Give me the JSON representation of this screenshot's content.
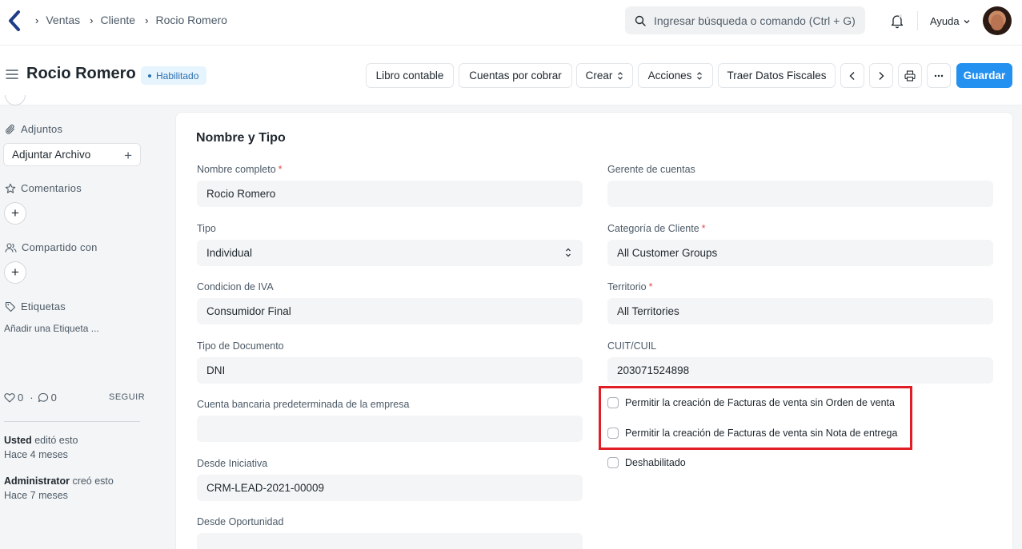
{
  "navbar": {
    "breadcrumbs": [
      "Ventas",
      "Cliente",
      "Rocio Romero"
    ],
    "search_placeholder": "Ingresar búsqueda o comando (Ctrl + G)",
    "help_label": "Ayuda"
  },
  "header": {
    "title": "Rocio Romero",
    "status": "Habilitado",
    "buttons": {
      "ledger": "Libro contable",
      "receivables": "Cuentas por cobrar",
      "create": "Crear",
      "actions": "Acciones",
      "fiscal": "Traer Datos Fiscales",
      "save": "Guardar"
    }
  },
  "sidebar": {
    "attachments_label": "Adjuntos",
    "attach_button": "Adjuntar Archivo",
    "comments_label": "Comentarios",
    "shared_label": "Compartido con",
    "tags_label": "Etiquetas",
    "add_tag": "Añadir una Etiqueta ...",
    "likes_count": "0",
    "comments_count": "0",
    "follow_label": "SEGUIR",
    "activity": [
      {
        "user": "Usted",
        "action": "editó esto",
        "when": "Hace 4 meses"
      },
      {
        "user": "Administrator",
        "action": "creó esto",
        "when": "Hace 7 meses"
      }
    ]
  },
  "form": {
    "section_title": "Nombre y Tipo",
    "left": {
      "full_name": {
        "label": "Nombre completo",
        "value": "Rocio Romero"
      },
      "type": {
        "label": "Tipo",
        "value": "Individual"
      },
      "iva": {
        "label": "Condicion de IVA",
        "value": "Consumidor Final"
      },
      "doc_type": {
        "label": "Tipo de Documento",
        "value": "DNI"
      },
      "bank_account": {
        "label": "Cuenta bancaria predeterminada de la empresa",
        "value": ""
      },
      "from_lead": {
        "label": "Desde Iniciativa",
        "value": "CRM-LEAD-2021-00009"
      },
      "from_opportunity": {
        "label": "Desde Oportunidad",
        "value": ""
      }
    },
    "right": {
      "account_manager": {
        "label": "Gerente de cuentas",
        "value": ""
      },
      "customer_group": {
        "label": "Categoría de Cliente",
        "value": "All Customer Groups"
      },
      "territory": {
        "label": "Territorio",
        "value": "All Territories"
      },
      "tax_id": {
        "label": "CUIT/CUIL",
        "value": "203071524898"
      }
    },
    "checkboxes": {
      "no_sales_order": "Permitir la creación de Facturas de venta sin Orden de venta",
      "no_delivery_note": "Permitir la creación de Facturas de venta sin Nota de entrega",
      "disabled": "Deshabilitado"
    }
  },
  "colors": {
    "primary": "#2490ef",
    "highlight": "#e11e26",
    "badge_bg": "#e6f4fd"
  }
}
